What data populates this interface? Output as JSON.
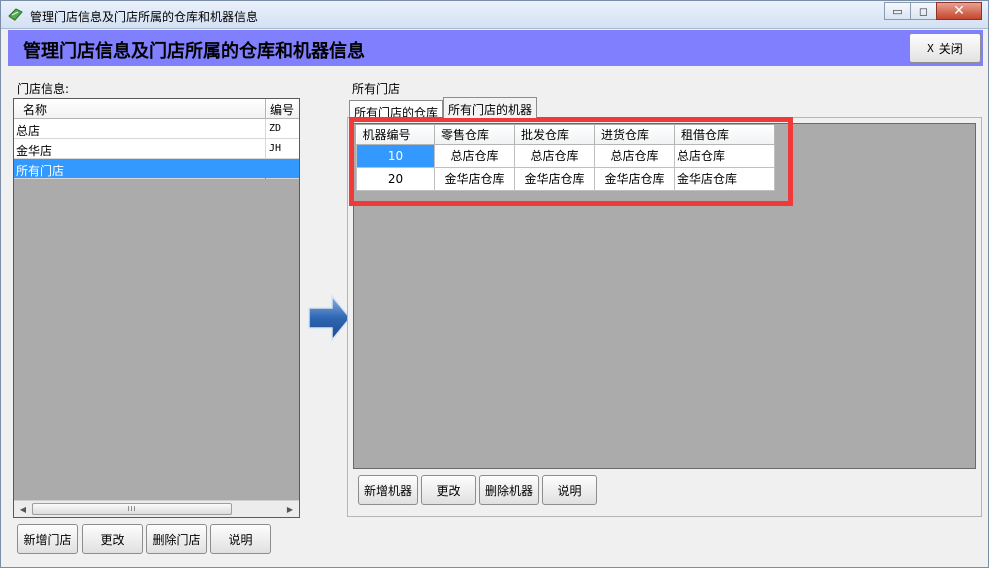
{
  "window": {
    "title": "管理门店信息及门店所属的仓库和机器信息",
    "minimize_glyph": "▭",
    "restore_glyph": "◻",
    "close_glyph": "✕"
  },
  "header": {
    "title": "管理门店信息及门店所属的仓库和机器信息",
    "close_icon": "X",
    "close_label": "关闭",
    "band_color": "#8080ff"
  },
  "store_panel": {
    "label": "门店信息:",
    "columns": [
      "名称",
      "编号"
    ],
    "rows": [
      {
        "name": "总店",
        "code": "ZD"
      },
      {
        "name": "金华店",
        "code": "JH"
      },
      {
        "name": "所有门店",
        "code": ""
      }
    ],
    "selected_index": 2,
    "scroll_left": "◀",
    "scroll_right": "▶",
    "scroll_grip": "III",
    "buttons": {
      "add": "新增门店",
      "edit": "更改",
      "delete": "删除门店",
      "help": "说明"
    }
  },
  "detail_panel": {
    "label": "所有门店",
    "tabs": [
      {
        "label": "所有门店的仓库"
      },
      {
        "label": "所有门店的机器"
      }
    ],
    "active_tab": 1,
    "columns": [
      "机器编号",
      "零售仓库",
      "批发仓库",
      "进货仓库",
      "租借仓库"
    ],
    "rows": [
      [
        "10",
        "总店仓库",
        "总店仓库",
        "总店仓库",
        "总店仓库"
      ],
      [
        "20",
        "金华店仓库",
        "金华店仓库",
        "金华店仓库",
        "金华店仓库"
      ]
    ],
    "buttons": {
      "add": "新增机器",
      "edit": "更改",
      "delete": "删除机器",
      "help": "说明"
    }
  },
  "colors": {
    "selection": "#3399ff",
    "highlight_frame": "#f03a3a",
    "grid_background": "#ababab"
  }
}
